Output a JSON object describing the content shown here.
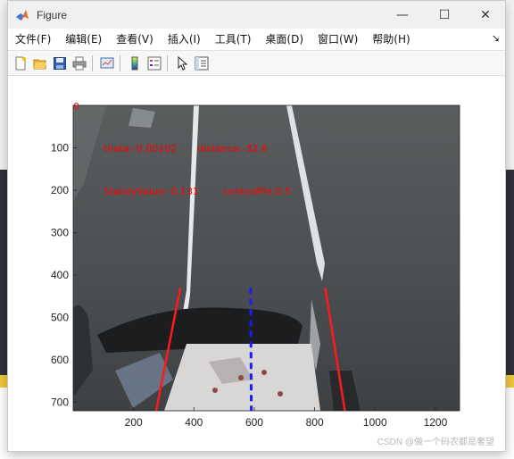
{
  "window": {
    "title": "Figure",
    "controls": {
      "minimize": "—",
      "maximize": "☐",
      "close": "✕"
    }
  },
  "menu": {
    "items": [
      "文件(F)",
      "编辑(E)",
      "查看(V)",
      "插入(I)",
      "工具(T)",
      "桌面(D)",
      "窗口(W)",
      "帮助(H)"
    ],
    "extra": "↘"
  },
  "toolbar": {
    "icons": [
      "new-figure-icon",
      "open-file-icon",
      "save-icon",
      "print-icon",
      "link-plot-icon",
      "insert-colorbar-icon",
      "insert-legend-icon",
      "pointer-icon",
      "property-inspector-icon"
    ]
  },
  "figure": {
    "corner_label": "0",
    "annotations": {
      "theta": "theta:-0.00102",
      "distance": "distance:-32.6",
      "stainly": "StainlyValue:-0.131",
      "control_phi": "controlPhi:0.5"
    },
    "annotation_color": "#ff0000"
  },
  "chart_data": {
    "type": "image",
    "xlim": [
      0,
      1280
    ],
    "ylim": [
      720,
      0
    ],
    "x_ticks": [
      200,
      400,
      600,
      800,
      1000,
      1200
    ],
    "y_ticks": [
      100,
      200,
      300,
      400,
      500,
      600,
      700
    ],
    "lines": [
      {
        "name": "left-lane-line",
        "color": "#ff1a1a",
        "style": "solid",
        "x": [
          355,
          275
        ],
        "y": [
          430,
          720
        ]
      },
      {
        "name": "right-lane-line",
        "color": "#ff1a1a",
        "style": "solid",
        "x": [
          835,
          900
        ],
        "y": [
          430,
          720
        ]
      },
      {
        "name": "center-line",
        "color": "#1a1aff",
        "style": "dashed",
        "x": [
          588,
          590
        ],
        "y": [
          430,
          720
        ]
      }
    ],
    "grid": false
  },
  "watermark": "CSDN @做一个码农都是奢望"
}
